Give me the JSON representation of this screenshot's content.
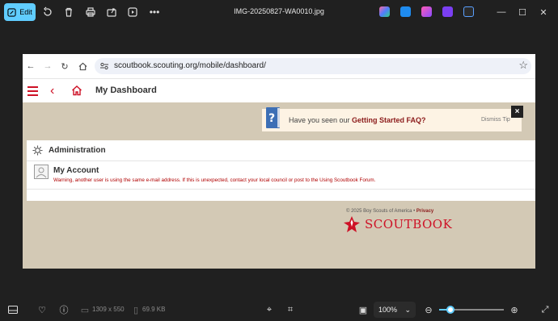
{
  "toolbar": {
    "edit_label": "Edit",
    "file_title": "IMG-20250827-WA0010.jpg"
  },
  "browser": {
    "url": "scoutbook.scouting.org/mobile/dashboard/"
  },
  "app": {
    "page_title": "My Dashboard",
    "faq_prefix": "Have you seen our ",
    "faq_link": "Getting Started FAQ?",
    "dismiss": "Dismiss Tip",
    "close": "×",
    "admin_title": "Administration",
    "account_title": "My Account",
    "account_warning": "Warning, another user is using the same e-mail address. If this is unexpected, contact your local council or post to the Using Scoutbook Forum.",
    "footer_copyright": "© 2025 Boy Scouts of America • ",
    "footer_privacy": "Privacy",
    "logo_text": "SCOUTBOOK"
  },
  "statusbar": {
    "dimensions": "1309 x 550",
    "filesize": "69.9 KB",
    "zoom": "100%",
    "zoom_fraction": 0.1
  },
  "colors": {
    "accent": "#60cdff",
    "scout_red": "#ce1126",
    "tan": "#d3c9b5"
  }
}
